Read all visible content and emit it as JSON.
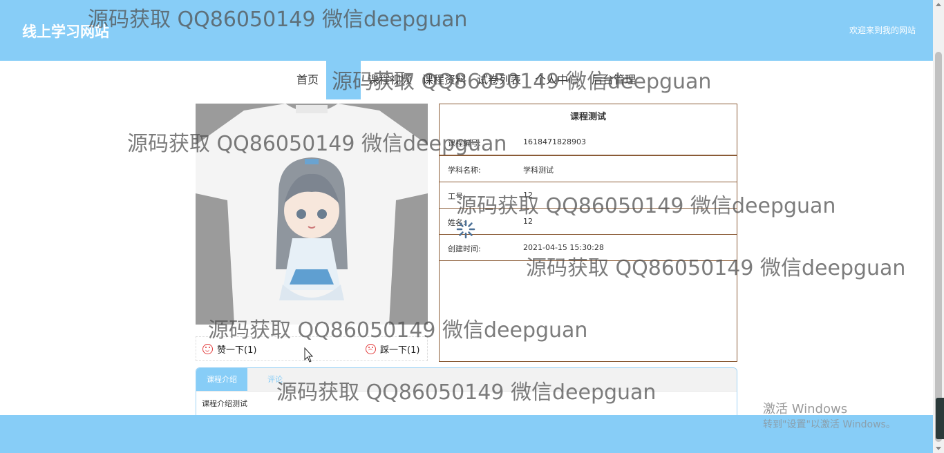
{
  "header": {
    "site_title": "线上学习网站",
    "welcome": "欢迎来到我的网站"
  },
  "nav": {
    "items": [
      "首页",
      "源码",
      "课程视频",
      "课程资料",
      "试卷列表",
      "个人中心",
      "后台管理"
    ],
    "active_index": 1
  },
  "vote": {
    "like_label": "赞一下(1)",
    "dislike_label": "踩一下(1)"
  },
  "info": {
    "title": "课程测试",
    "rows": [
      {
        "label": "课程编号:",
        "value": "1618471828903"
      },
      {
        "label": "学科名称:",
        "value": "学科测试"
      },
      {
        "label": "工号:",
        "value": "12"
      },
      {
        "label": "姓名:",
        "value": "12"
      },
      {
        "label": "创建时间:",
        "value": "2021-04-15 15:30:28"
      }
    ]
  },
  "tabs": {
    "items": [
      "课程介绍",
      "评论"
    ],
    "content": "课程介绍测试"
  },
  "watermark": "源码获取 QQ86050149 微信deepguan",
  "activate": {
    "line1": "激活 Windows",
    "line2": "转到\"设置\"以激活 Windows。"
  },
  "colors": {
    "accent": "#87cdf7",
    "border": "#8a5a35",
    "vote_icon": "#e23b3b"
  },
  "icons": {
    "like": "smile-icon",
    "dislike": "frown-icon",
    "loading": "spinner-icon",
    "cursor": "mouse-pointer-icon"
  }
}
